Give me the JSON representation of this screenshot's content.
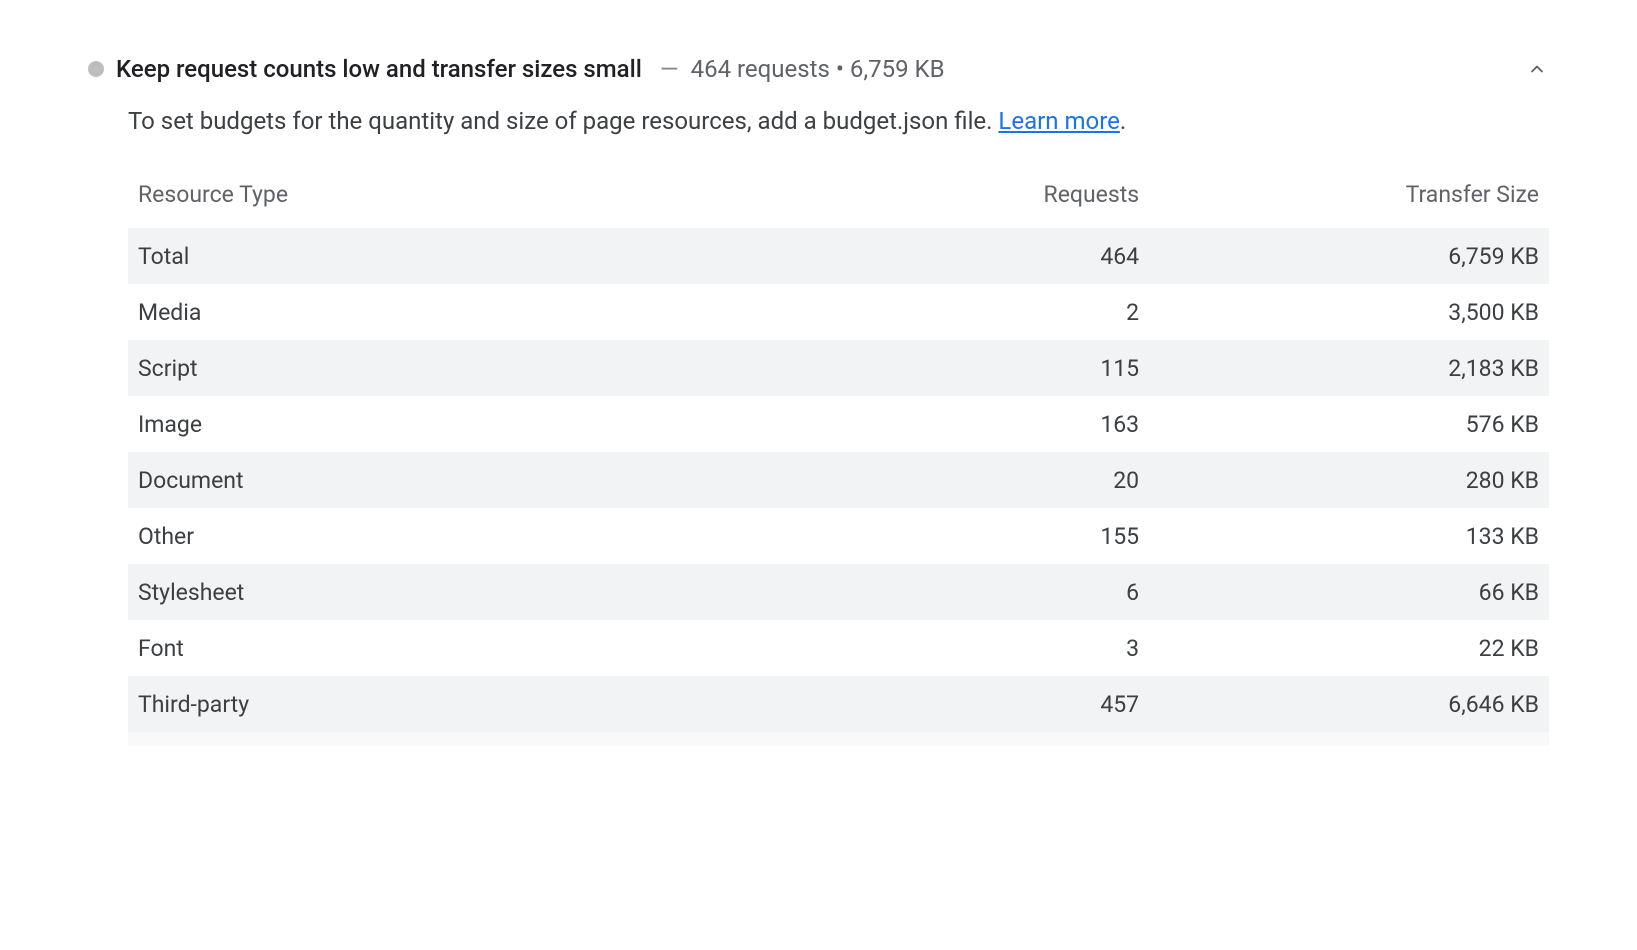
{
  "audit": {
    "title": "Keep request counts low and transfer sizes small",
    "summary_sep": "—",
    "summary": "464 requests • 6,759 KB",
    "description_prefix": "To set budgets for the quantity and size of page resources, add a budget.json file. ",
    "learn_more": "Learn more",
    "description_suffix": "."
  },
  "table": {
    "headers": {
      "type": "Resource Type",
      "requests": "Requests",
      "size": "Transfer Size"
    },
    "rows": [
      {
        "type": "Total",
        "requests": "464",
        "size": "6,759 KB"
      },
      {
        "type": "Media",
        "requests": "2",
        "size": "3,500 KB"
      },
      {
        "type": "Script",
        "requests": "115",
        "size": "2,183 KB"
      },
      {
        "type": "Image",
        "requests": "163",
        "size": "576 KB"
      },
      {
        "type": "Document",
        "requests": "20",
        "size": "280 KB"
      },
      {
        "type": "Other",
        "requests": "155",
        "size": "133 KB"
      },
      {
        "type": "Stylesheet",
        "requests": "6",
        "size": "66 KB"
      },
      {
        "type": "Font",
        "requests": "3",
        "size": "22 KB"
      },
      {
        "type": "Third-party",
        "requests": "457",
        "size": "6,646 KB"
      }
    ]
  }
}
